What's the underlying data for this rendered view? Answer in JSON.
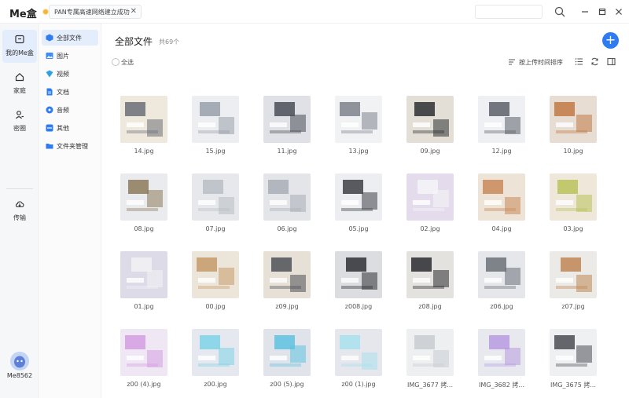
{
  "app": {
    "name": "Me盒"
  },
  "tab": {
    "title": "PAN专属高速网络建立成功"
  },
  "colors": {
    "accent": "#2f7bf0",
    "active_bg": "#e4edfb"
  },
  "rail": {
    "items": [
      {
        "label": "我的Me盒",
        "icon": "box-icon",
        "active": true
      },
      {
        "label": "家庭",
        "icon": "home-icon",
        "active": false
      },
      {
        "label": "密圈",
        "icon": "people-icon",
        "active": false
      },
      {
        "label": "传输",
        "icon": "cloud-transfer-icon",
        "active": false
      }
    ],
    "user": "Me8562"
  },
  "categories": [
    {
      "label": "全部文件",
      "icon": "cube-icon",
      "color": "#2f7bf0"
    },
    {
      "label": "图片",
      "icon": "image-icon",
      "color": "#3a8ef6"
    },
    {
      "label": "视频",
      "icon": "video-icon",
      "color": "#2fa0e6"
    },
    {
      "label": "文档",
      "icon": "document-icon",
      "color": "#2f7bf0"
    },
    {
      "label": "音频",
      "icon": "audio-icon",
      "color": "#2f7bf0"
    },
    {
      "label": "其他",
      "icon": "other-icon",
      "color": "#2f7bf0"
    },
    {
      "label": "文件夹管理",
      "icon": "folder-icon",
      "color": "#2f7bf0"
    }
  ],
  "main": {
    "title": "全部文件",
    "count": "共69个",
    "select_all": "全选",
    "sort_label": "按上传时间排序"
  },
  "files": [
    {
      "name": "14.jpg",
      "bg": "#efe8dc",
      "accent": "#6b6f78"
    },
    {
      "name": "15.jpg",
      "bg": "#eceef1",
      "accent": "#9aa0aa"
    },
    {
      "name": "11.jpg",
      "bg": "#dfe1e6",
      "accent": "#4a4e56"
    },
    {
      "name": "13.jpg",
      "bg": "#f1f2f4",
      "accent": "#7d838c"
    },
    {
      "name": "09.jpg",
      "bg": "#e3dfd6",
      "accent": "#2d2f33"
    },
    {
      "name": "12.jpg",
      "bg": "#eef0f3",
      "accent": "#5c6068"
    },
    {
      "name": "10.jpg",
      "bg": "#e7ddd2",
      "accent": "#c17a45"
    },
    {
      "name": "08.jpg",
      "bg": "#e9ebee",
      "accent": "#8d7a5a"
    },
    {
      "name": "07.jpg",
      "bg": "#e6e8ec",
      "accent": "#b8bdc5"
    },
    {
      "name": "06.jpg",
      "bg": "#e3e5e9",
      "accent": "#a9aeb6"
    },
    {
      "name": "05.jpg",
      "bg": "#edeef1",
      "accent": "#3d4047"
    },
    {
      "name": "02.jpg",
      "bg": "#e4dcec",
      "accent": "#f5f5f7"
    },
    {
      "name": "04.jpg",
      "bg": "#ede3d6",
      "accent": "#c98a5a"
    },
    {
      "name": "03.jpg",
      "bg": "#efe7da",
      "accent": "#b8c25a"
    },
    {
      "name": "01.jpg",
      "bg": "#dedbe9",
      "accent": "#f2f2f4"
    },
    {
      "name": "00.jpg",
      "bg": "#ece6da",
      "accent": "#c79a6a"
    },
    {
      "name": "z09.jpg",
      "bg": "#e6e0d6",
      "accent": "#4e5158"
    },
    {
      "name": "z008.jpg",
      "bg": "#dcdde1",
      "accent": "#2e3035"
    },
    {
      "name": "z08.jpg",
      "bg": "#e4e2de",
      "accent": "#2a2c30"
    },
    {
      "name": "z06.jpg",
      "bg": "#e5e7ea",
      "accent": "#6c7078"
    },
    {
      "name": "z07.jpg",
      "bg": "#eceae6",
      "accent": "#c08656"
    },
    {
      "name": "z00 (4).jpg",
      "bg": "#efe7f3",
      "accent": "#d59ee3"
    },
    {
      "name": "z00.jpg",
      "bg": "#e5e8ef",
      "accent": "#7fd3e6"
    },
    {
      "name": "z00 (5).jpg",
      "bg": "#e0e3ea",
      "accent": "#5ec3e0"
    },
    {
      "name": "z00 (1).jpg",
      "bg": "#e6e7ec",
      "accent": "#a8e0ef"
    },
    {
      "name": "IMG_3677 拷...",
      "bg": "#eeeff1",
      "accent": "#c8ccd2"
    },
    {
      "name": "IMG_3682 拷...",
      "bg": "#e8e9ee",
      "accent": "#b79be0"
    },
    {
      "name": "IMG_3675 拷...",
      "bg": "#eff0f2",
      "accent": "#4b4e55"
    }
  ]
}
